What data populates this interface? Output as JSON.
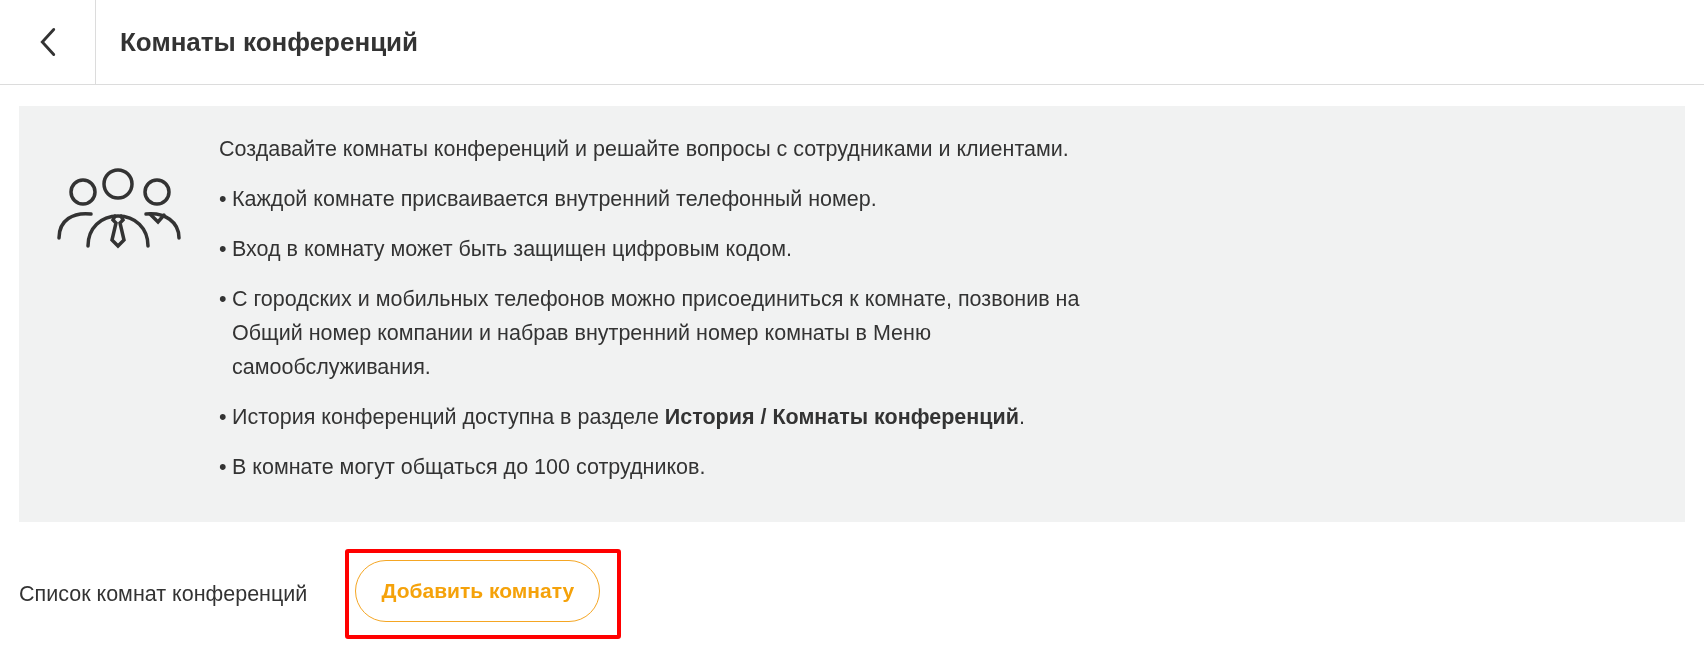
{
  "header": {
    "title": "Комнаты конференций"
  },
  "info_panel": {
    "paragraphs": [
      {
        "text": "Создавайте комнаты конференций и решайте вопросы с сотрудниками и клиентами."
      },
      {
        "bullet": "•",
        "text": "Каждой комнате присваивается внутренний телефонный номер."
      },
      {
        "bullet": "•",
        "text": "Вход в комнату может быть защищен цифровым кодом."
      },
      {
        "bullet": "•",
        "text": "С городских и мобильных телефонов можно присоединиться к комнате, позвонив на Общий номер компании и набрав внутренний номер комнаты в Меню самообслуживания."
      },
      {
        "bullet": "•",
        "text": "История конференций доступна в разделе **История / Комнаты конференций**."
      },
      {
        "bullet": "•",
        "text": "В комнате могут общаться до 100 сотрудников."
      }
    ]
  },
  "rooms": {
    "label": "Список комнат конференций",
    "add_button": {
      "label": "Добавить комнату",
      "highlighted": true
    }
  }
}
